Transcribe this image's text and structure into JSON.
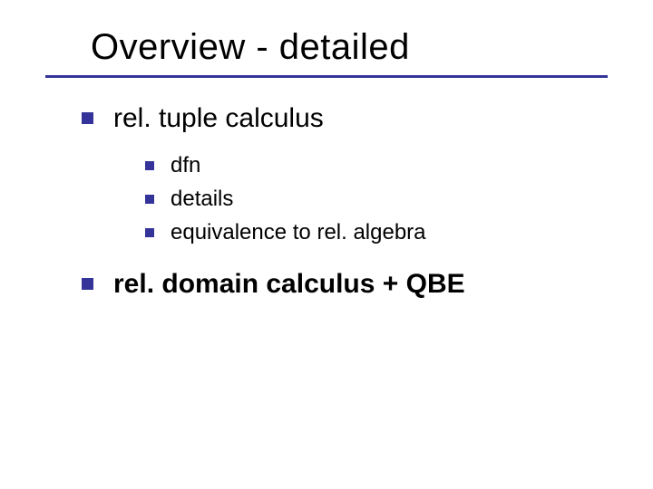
{
  "title": "Overview - detailed",
  "items": [
    {
      "label": "rel. tuple calculus",
      "bold": false,
      "children": [
        {
          "label": "dfn"
        },
        {
          "label": "details"
        },
        {
          "label": "equivalence to rel. algebra"
        }
      ]
    },
    {
      "label": "rel. domain calculus + QBE",
      "bold": true,
      "children": []
    }
  ]
}
